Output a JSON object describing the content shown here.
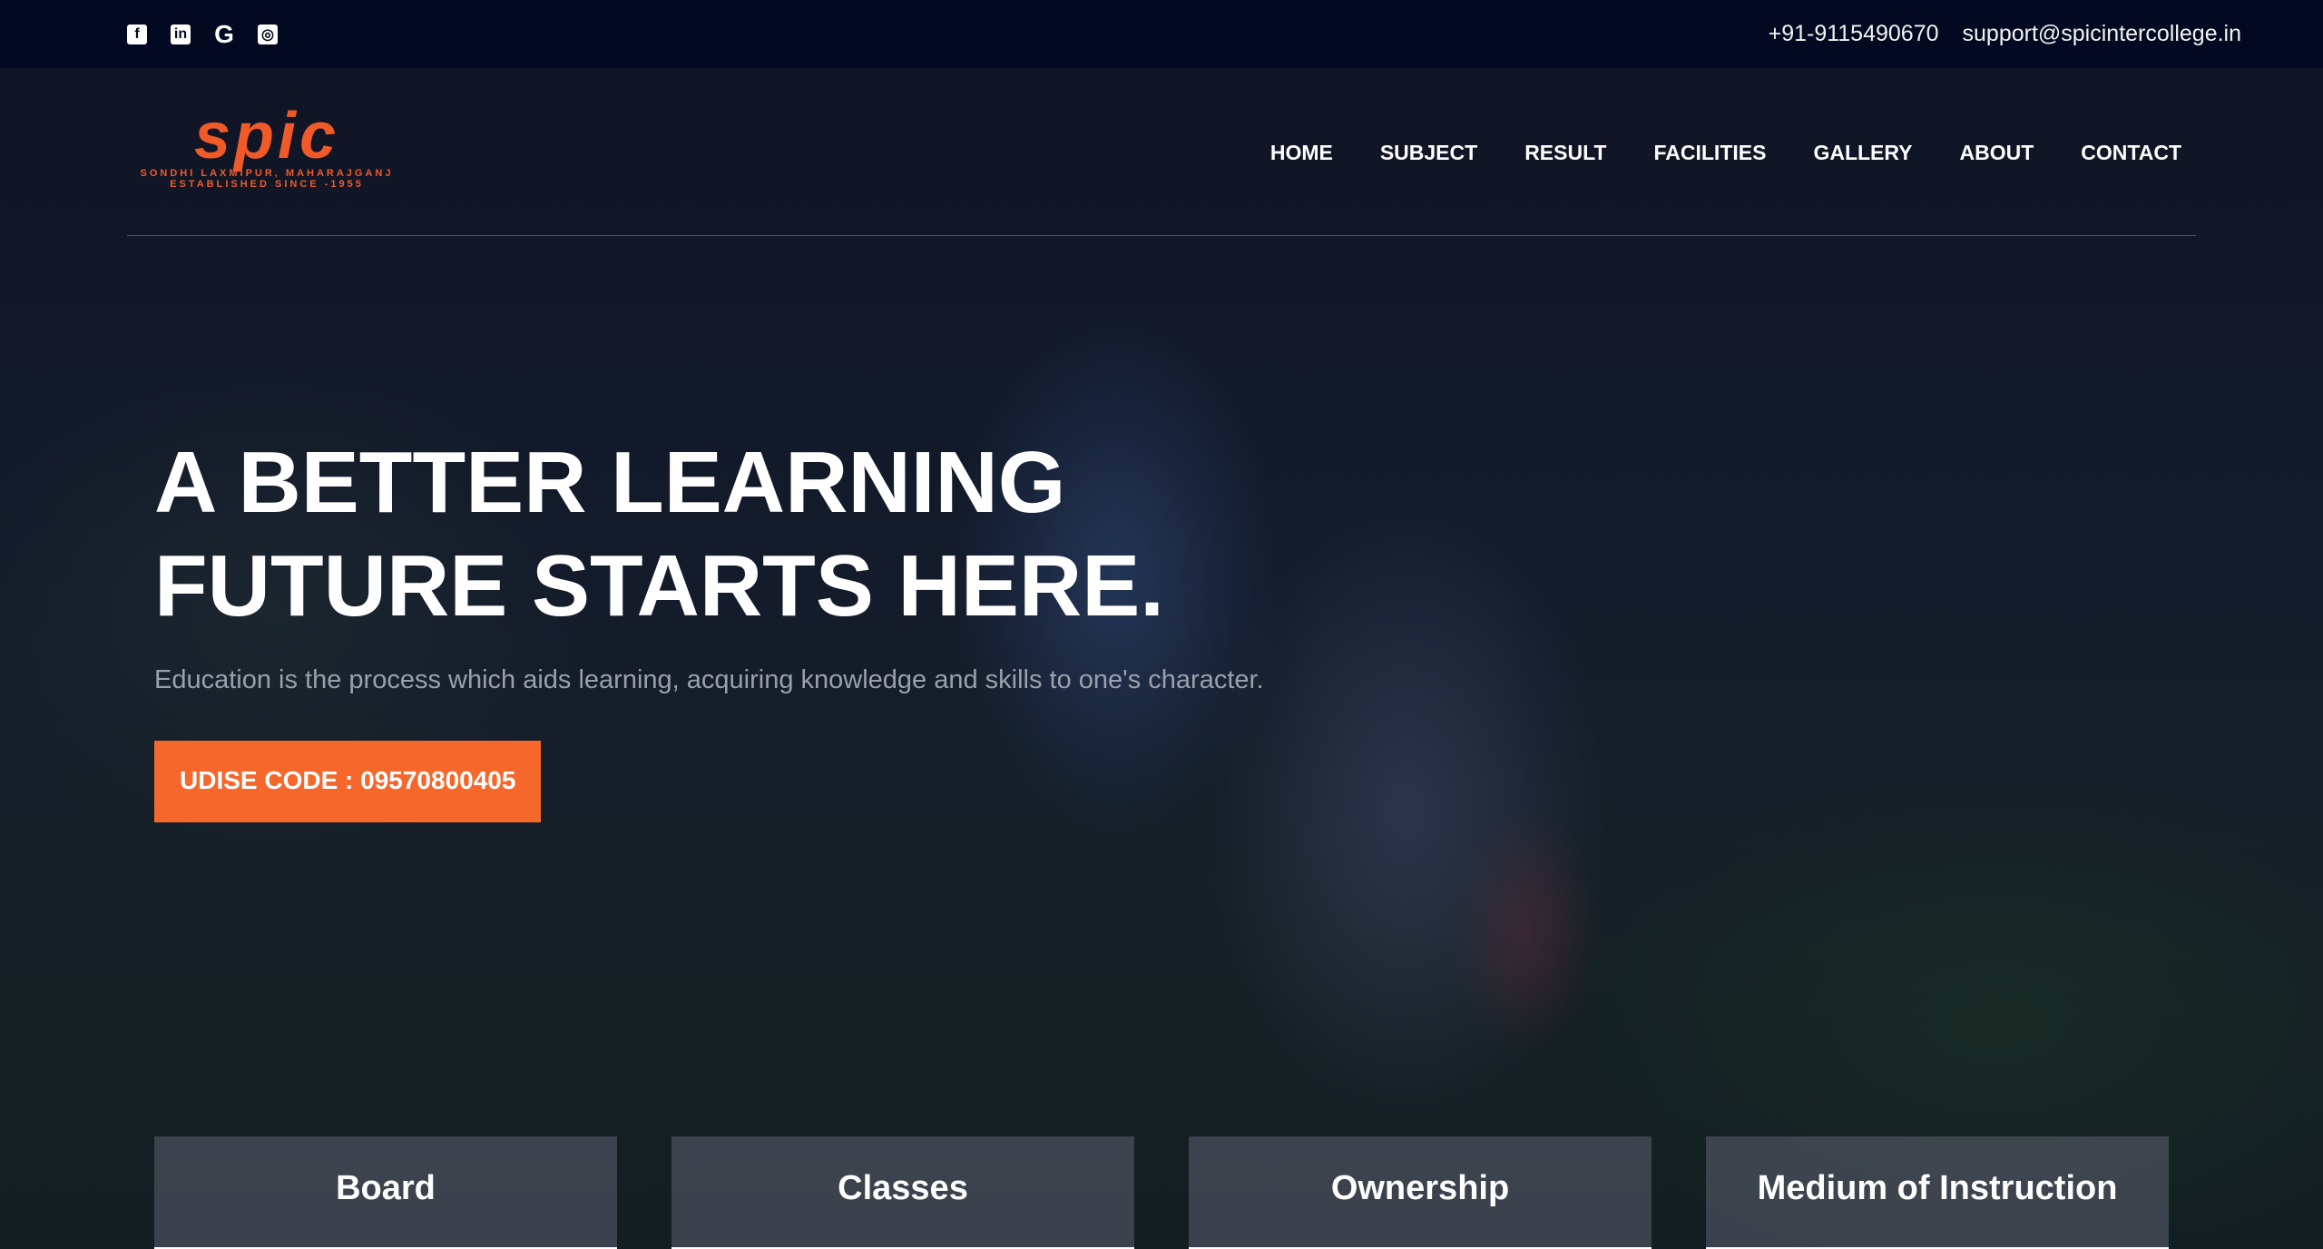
{
  "topbar": {
    "socials": [
      "facebook-icon",
      "linkedin-icon",
      "google-icon",
      "instagram-icon"
    ],
    "phone": "+91-9115490670",
    "email": "support@spicintercollege.in"
  },
  "logo": {
    "mark": "spic",
    "line1": "SONDHI LAXMIPUR, MAHARAJGANJ",
    "line2": "ESTABLISHED SINCE -1955"
  },
  "nav": [
    "HOME",
    "SUBJECT",
    "RESULT",
    "FACILITIES",
    "GALLERY",
    "ABOUT",
    "CONTACT"
  ],
  "hero": {
    "title": "A BETTER LEARNING FUTURE STARTS HERE.",
    "subtitle": "Education is the process which aids learning, acquiring knowledge and skills to one's character.",
    "button": "UDISE CODE : 09570800405"
  },
  "cards": [
    "Board",
    "Classes",
    "Ownership",
    "Medium of Instruction"
  ],
  "colors": {
    "accent": "#f5672a",
    "topbar": "#030920"
  }
}
